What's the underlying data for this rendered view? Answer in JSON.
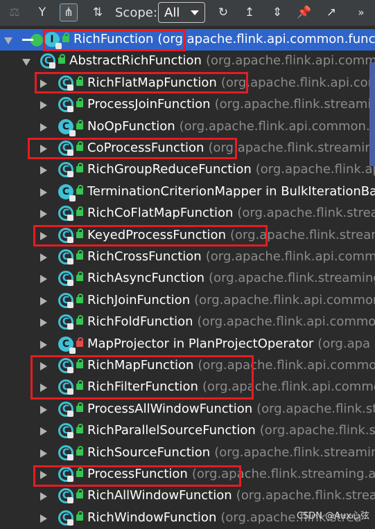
{
  "toolbar": {
    "scope_label": "Scope:",
    "scope_value": "All",
    "buttons": [
      {
        "icon": "supertype-hierarchy-icon",
        "disabled": true
      },
      {
        "icon": "subtype-hierarchy-icon"
      },
      {
        "icon": "class-hierarchy-icon",
        "active": true
      },
      {
        "icon": "sort-alphabetically-icon"
      },
      {
        "icon": "refresh-icon"
      },
      {
        "icon": "export-icon"
      },
      {
        "icon": "expand-all-icon"
      },
      {
        "icon": "pin-icon"
      },
      {
        "icon": "open-in-editor-icon"
      },
      {
        "icon": "more-icon"
      }
    ]
  },
  "tree": {
    "rows": [
      {
        "name": "RichFunction",
        "pkg": "(org.apache.flink.api.common.function",
        "level": 0,
        "selected": true,
        "expanded": true,
        "icon": "interface-icon"
      },
      {
        "name": "AbstractRichFunction",
        "pkg": "(org.apache.flink.api.commo",
        "level": 1,
        "expanded": true,
        "icon": "abstract-class-icon"
      },
      {
        "name": "RichFlatMapFunction",
        "pkg": "(org.apache.flink.api.com",
        "level": 2,
        "icon": "abstract-class-icon"
      },
      {
        "name": "ProcessJoinFunction",
        "pkg": "(org.apache.flink.streamin",
        "level": 2,
        "icon": "abstract-class-icon"
      },
      {
        "name": "NoOpFunction",
        "pkg": "(org.apache.flink.api.common.f",
        "level": 2,
        "icon": "class-icon"
      },
      {
        "name": "CoProcessFunction",
        "pkg": "(org.apache.flink.streaming",
        "level": 2,
        "icon": "abstract-class-icon"
      },
      {
        "name": "RichGroupReduceFunction",
        "pkg": "(org.apache.flink.api.",
        "level": 2,
        "icon": "abstract-class-icon"
      },
      {
        "name": "TerminationCriterionMapper in BulkIterationBa",
        "pkg": "",
        "level": 2,
        "icon": "class-icon"
      },
      {
        "name": "RichCoFlatMapFunction",
        "pkg": "(org.apache.flink.strea",
        "level": 2,
        "icon": "abstract-class-icon"
      },
      {
        "name": "KeyedProcessFunction",
        "pkg": "(org.apache.flink.stream",
        "level": 2,
        "icon": "abstract-class-icon"
      },
      {
        "name": "RichCrossFunction",
        "pkg": "(org.apache.flink.api.comm",
        "level": 2,
        "icon": "abstract-class-icon"
      },
      {
        "name": "RichAsyncFunction",
        "pkg": "(org.apache.flink.streaming",
        "level": 2,
        "icon": "abstract-class-icon"
      },
      {
        "name": "RichJoinFunction",
        "pkg": "(org.apache.flink.api.common",
        "level": 2,
        "icon": "abstract-class-icon"
      },
      {
        "name": "RichFoldFunction",
        "pkg": "(org.apache.flink.api.commo",
        "level": 2,
        "icon": "abstract-class-icon"
      },
      {
        "name": "MapProjector in PlanProjectOperator",
        "pkg": "(org.apa",
        "level": 2,
        "icon": "class-icon",
        "private": true
      },
      {
        "name": "RichMapFunction",
        "pkg": "(org.apache.flink.api.commo",
        "level": 2,
        "icon": "abstract-class-icon"
      },
      {
        "name": "RichFilterFunction",
        "pkg": "(org.apache.flink.api.commo",
        "level": 2,
        "icon": "abstract-class-icon"
      },
      {
        "name": "ProcessAllWindowFunction",
        "pkg": "(org.apache.flink.st",
        "level": 2,
        "icon": "abstract-class-icon"
      },
      {
        "name": "RichParallelSourceFunction",
        "pkg": "(org.apache.flink.st",
        "level": 2,
        "icon": "abstract-class-icon"
      },
      {
        "name": "RichSourceFunction",
        "pkg": "(org.apache.flink.streamin",
        "level": 2,
        "icon": "abstract-class-icon"
      },
      {
        "name": "ProcessFunction",
        "pkg": "(org.apache.flink.streaming.ap",
        "level": 2,
        "icon": "abstract-class-icon"
      },
      {
        "name": "RichAllWindowFunction",
        "pkg": "(org.apache.flink.strea",
        "level": 2,
        "icon": "abstract-class-icon"
      },
      {
        "name": "RichWindowFunction",
        "pkg": "(org.apache.flink.strea",
        "level": 2,
        "icon": "abstract-class-icon"
      }
    ]
  },
  "watermark": "CSDN @Aux心弦",
  "colors": {
    "selection": "#2f65ca",
    "highlight_box": "#e51c23",
    "class_icon": "#3fc1d6",
    "public_lock": "#37c452",
    "private_lock": "#e14c4c"
  }
}
